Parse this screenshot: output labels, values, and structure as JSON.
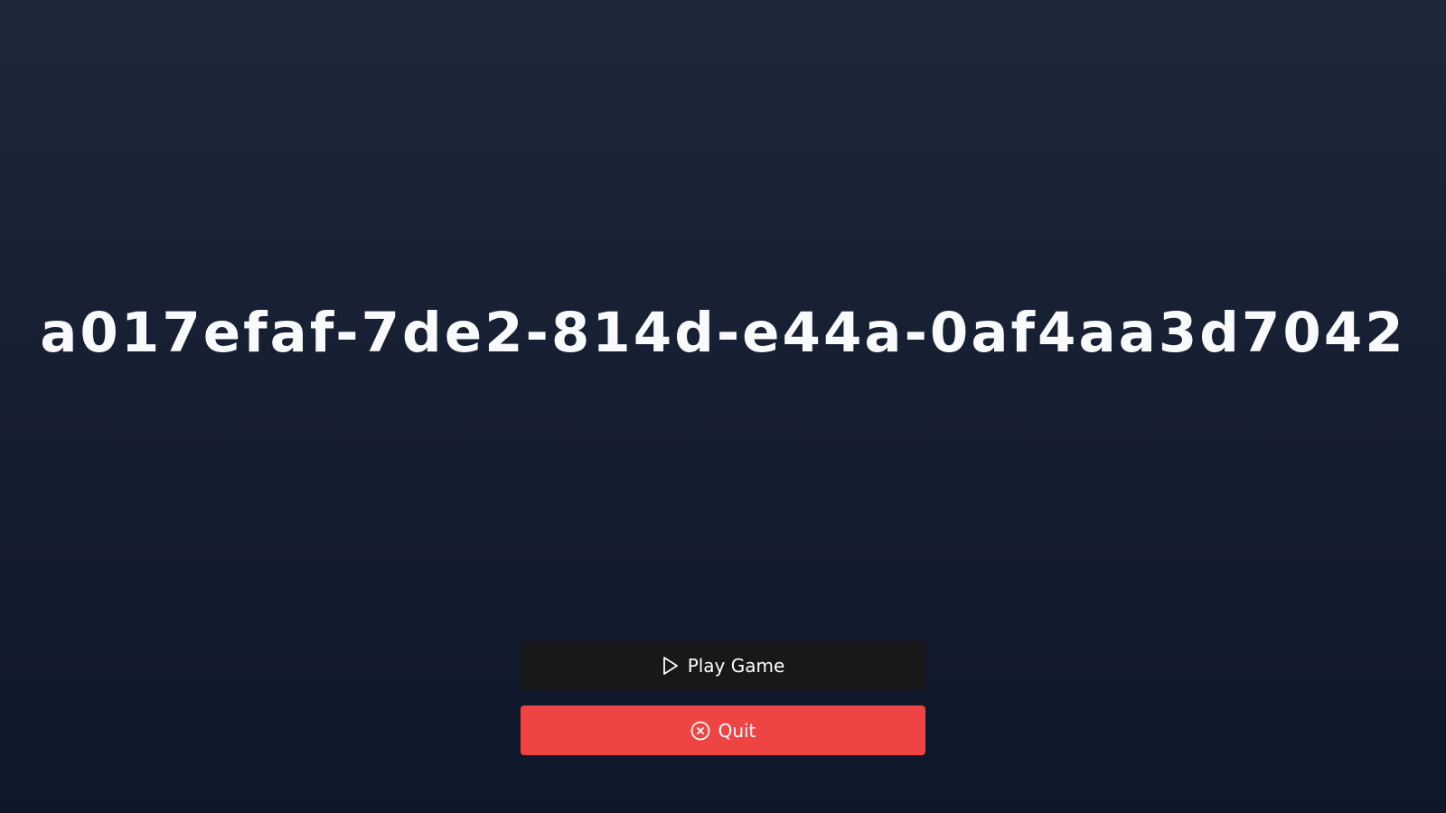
{
  "title": "a017efaf-7de2-814d-e44a-0af4aa3d7042",
  "menu": {
    "play_label": "Play Game",
    "play_icon": "play-icon",
    "quit_label": "Quit",
    "quit_icon": "circle-x-icon"
  },
  "colors": {
    "background_top": "#1e283b",
    "background_bottom": "#0f172a",
    "play_button": "#18181b",
    "quit_button": "#ef4444",
    "text": "#ffffff"
  }
}
